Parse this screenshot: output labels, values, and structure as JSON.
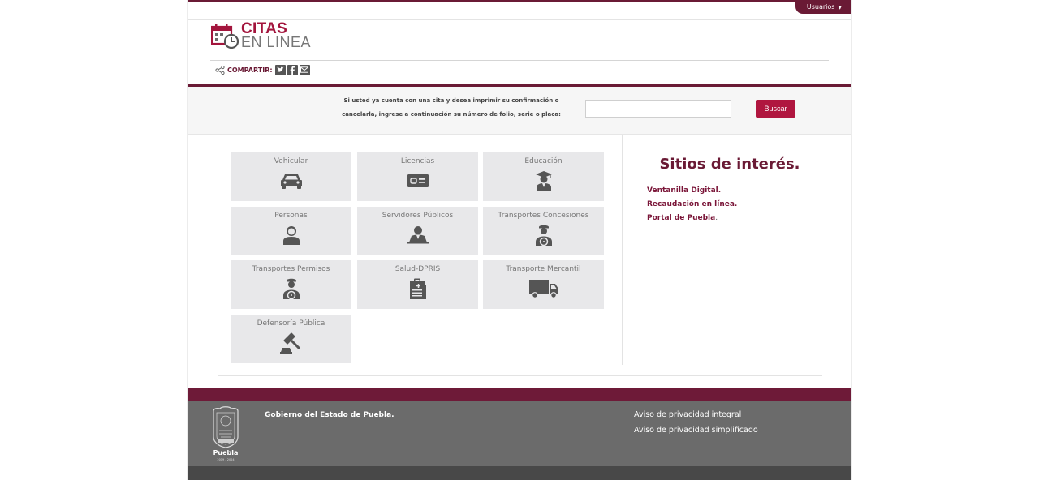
{
  "header": {
    "user_menu": "Usuarios",
    "logo_line1": "CITAS",
    "logo_line2": "EN LINEA",
    "share_label": "COMPARTIR:"
  },
  "search": {
    "prompt_line1": "Si usted ya cuenta con una cita y desea imprimir su confirmación o",
    "prompt_line2": "cancelarla, ingrese a continuación su número de folio, serie o placa:",
    "input_value": "",
    "button_label": "Buscar"
  },
  "services": [
    {
      "label": "Vehicular",
      "icon": "car-icon"
    },
    {
      "label": "Licencias",
      "icon": "id-card-icon"
    },
    {
      "label": "Educación",
      "icon": "graduate-icon"
    },
    {
      "label": "Personas",
      "icon": "person-icon"
    },
    {
      "label": "Servidores Públicos",
      "icon": "public-servant-icon"
    },
    {
      "label": "Transportes Concesiones",
      "icon": "driver-icon"
    },
    {
      "label": "Transportes Permisos",
      "icon": "driver-icon"
    },
    {
      "label": "Salud-DPRIS",
      "icon": "clipboard-icon"
    },
    {
      "label": "Transporte Mercantil",
      "icon": "truck-icon"
    },
    {
      "label": "Defensoría Pública",
      "icon": "gavel-icon"
    }
  ],
  "sidebar": {
    "title": "Sitios de interés.",
    "links": [
      {
        "label": "Ventanilla Digital",
        "suffix": "."
      },
      {
        "label": "Recaudación en línea",
        "suffix": "."
      },
      {
        "label": "Portal de Puebla",
        "suffix": "."
      }
    ]
  },
  "footer": {
    "government": "Gobierno del Estado de Puebla.",
    "privacy_full": "Aviso de privacidad integral",
    "privacy_simplified": "Aviso de privacidad simplificado",
    "crest_word": "Puebla",
    "crest_subtitle": "2019 - 2024"
  },
  "colors": {
    "brand": "#6a1a35",
    "button": "#b0163f",
    "tile": "#e8e8ea",
    "icon": "#555555"
  }
}
